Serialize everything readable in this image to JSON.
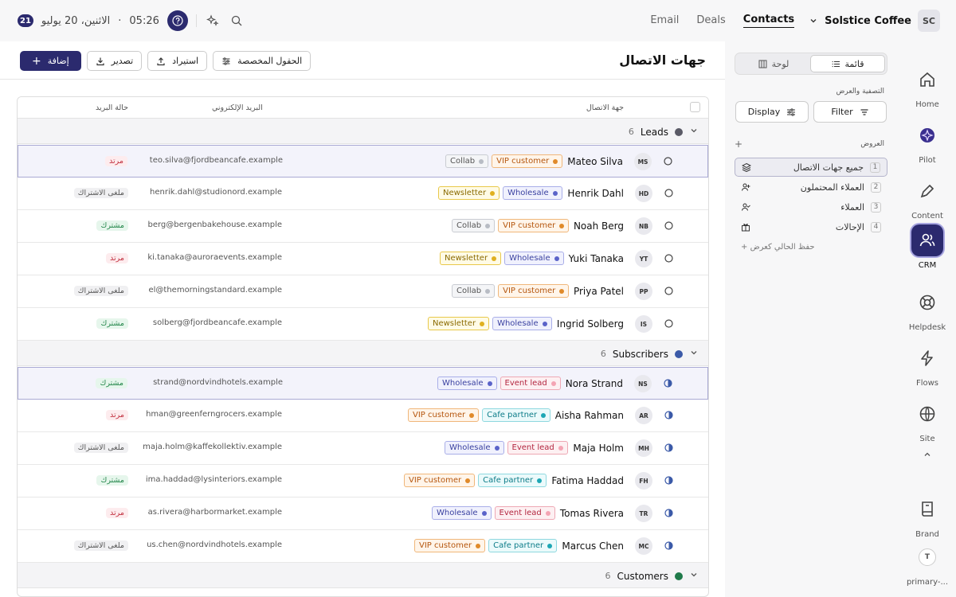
{
  "topbar": {
    "badge": "21",
    "date": "الاثنين، 20 يوليو",
    "sep": "·",
    "time": "05:26",
    "nav": [
      "Email",
      "Deals",
      "Contacts"
    ],
    "active_nav": "Contacts",
    "workspace": "Solstice Coffee",
    "avatar": "SC"
  },
  "rail": [
    {
      "label": "Home",
      "icon": "home-icon"
    },
    {
      "label": "Pilot",
      "icon": "pilot-icon"
    },
    {
      "label": "Content",
      "icon": "pen-icon"
    },
    {
      "label": "CRM",
      "icon": "users-icon",
      "active": true
    },
    {
      "label": "Helpdesk",
      "icon": "lifebuoy-icon"
    },
    {
      "label": "Flows",
      "icon": "bolt-icon"
    },
    {
      "label": "Site",
      "icon": "globe-icon"
    },
    {
      "label": "Brand",
      "icon": "book-icon"
    },
    {
      "label": "primary-...",
      "icon": "user-avatar",
      "avatar": "T"
    }
  ],
  "views_panel": {
    "seg_list": "قائمة",
    "seg_board": "لوحة",
    "filter_label": "التصفية والعرض",
    "filter_btn": "Filter",
    "display_btn": "Display",
    "views_label": "العروض",
    "add": "+",
    "views": [
      {
        "label": "جميع جهات الاتصال",
        "num": "1",
        "icon": "layers-icon"
      },
      {
        "label": "العملاء المحتملون",
        "num": "2",
        "icon": "user-plus-icon"
      },
      {
        "label": "العملاء",
        "num": "3",
        "icon": "user-check-icon"
      },
      {
        "label": "الإحالات",
        "num": "4",
        "icon": "gift-icon"
      }
    ],
    "save_view": "+ حفظ الحالي كعرض"
  },
  "header": {
    "title": "جهات الاتصال",
    "custom_fields": "الحقول المخصصة",
    "import": "استيراد",
    "export": "تصدير",
    "add": "إضافة"
  },
  "table": {
    "col_contact": "جهة الاتصال",
    "col_email": "البريد الإلكتروني",
    "col_status": "حالة البريد",
    "groups": [
      {
        "name": "Leads",
        "count": "6",
        "color": "#5a5a66",
        "rows": [
          {
            "initials": "MS",
            "name": "Mateo Silva",
            "tags": [
              "Collab",
              "VIP customer"
            ],
            "email": "teo.silva@fjordbeancafe.example",
            "status": "مرتد",
            "sel": true
          },
          {
            "initials": "HD",
            "name": "Henrik Dahl",
            "tags": [
              "Newsletter",
              "Wholesale"
            ],
            "email": "henrik.dahl@studionord.example",
            "status": "ملغى الاشتراك"
          },
          {
            "initials": "NB",
            "name": "Noah Berg",
            "tags": [
              "Collab",
              "VIP customer"
            ],
            "email": "berg@bergenbakehouse.example",
            "status": "مشترك"
          },
          {
            "initials": "YT",
            "name": "Yuki Tanaka",
            "tags": [
              "Newsletter",
              "Wholesale"
            ],
            "email": "ki.tanaka@auroraevents.example",
            "status": "مرتد"
          },
          {
            "initials": "PP",
            "name": "Priya Patel",
            "tags": [
              "Collab",
              "VIP customer"
            ],
            "email": "el@themorningstandard.example",
            "status": "ملغى الاشتراك"
          },
          {
            "initials": "IS",
            "name": "Ingrid Solberg",
            "tags": [
              "Newsletter",
              "Wholesale"
            ],
            "email": "solberg@fjordbeancafe.example",
            "status": "مشترك"
          }
        ]
      },
      {
        "name": "Subscribers",
        "count": "6",
        "color": "#3b5aa8",
        "rows": [
          {
            "initials": "NS",
            "name": "Nora Strand",
            "tags": [
              "Wholesale",
              "Event lead"
            ],
            "email": "strand@nordvindhotels.example",
            "status": "مشترك",
            "sel": true
          },
          {
            "initials": "AR",
            "name": "Aisha Rahman",
            "tags": [
              "VIP customer",
              "Cafe partner"
            ],
            "email": "hman@greenferngrocers.example",
            "status": "مرتد"
          },
          {
            "initials": "MH",
            "name": "Maja Holm",
            "tags": [
              "Wholesale",
              "Event lead"
            ],
            "email": "maja.holm@kaffekollektiv.example",
            "status": "ملغى الاشتراك"
          },
          {
            "initials": "FH",
            "name": "Fatima Haddad",
            "tags": [
              "VIP customer",
              "Cafe partner"
            ],
            "email": "ima.haddad@lysinteriors.example",
            "status": "مشترك"
          },
          {
            "initials": "TR",
            "name": "Tomas Rivera",
            "tags": [
              "Wholesale",
              "Event lead"
            ],
            "email": "as.rivera@harbormarket.example",
            "status": "مرتد"
          },
          {
            "initials": "MC",
            "name": "Marcus Chen",
            "tags": [
              "VIP customer",
              "Cafe partner"
            ],
            "email": "us.chen@nordvindhotels.example",
            "status": "ملغى الاشتراك"
          }
        ]
      },
      {
        "name": "Customers",
        "count": "6",
        "color": "#1f7a4a",
        "rows": []
      }
    ]
  },
  "colors": {
    "accent": "#2b2a6e",
    "tag_Collab": "#9aa0a8",
    "tag_VIP customer": "#e08a2a",
    "tag_Newsletter": "#d4a017",
    "tag_Wholesale": "#5a63c9",
    "tag_Event lead": "#d9536b",
    "tag_Cafe partner": "#1ea7b5",
    "status_مرتد": "#d64550",
    "status_ملغى الاشتراك": "#666",
    "status_مشترك": "#2d9a55"
  }
}
